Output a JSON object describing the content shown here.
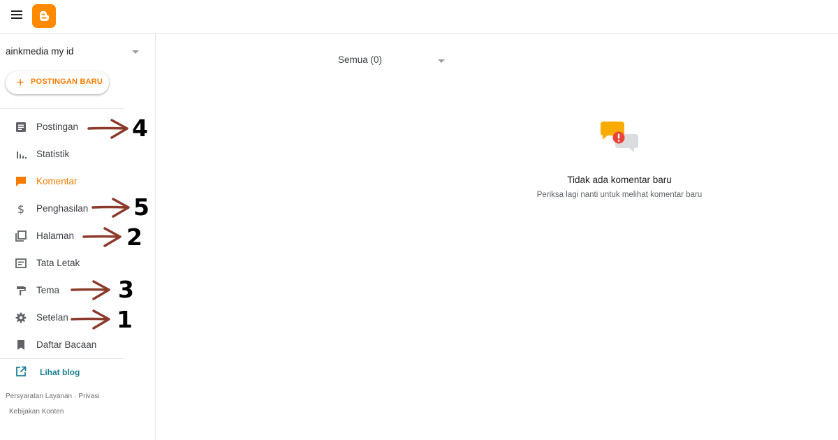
{
  "header": {
    "menu_icon": "hamburger-icon",
    "logo_icon": "blogger-logo-icon",
    "brand_color": "#ff8a00"
  },
  "sidebar": {
    "blog_name": "ainkmedia my id",
    "new_post_label": "POSTINGAN BARU",
    "accent_color": "#f57c00",
    "items": [
      {
        "label": "Postingan",
        "icon": "posts-icon"
      },
      {
        "label": "Statistik",
        "icon": "stats-icon"
      },
      {
        "label": "Komentar",
        "icon": "comment-icon",
        "active": true
      },
      {
        "label": "Penghasilan",
        "icon": "dollar-icon"
      },
      {
        "label": "Halaman",
        "icon": "pages-icon"
      },
      {
        "label": "Tata Letak",
        "icon": "layout-icon"
      },
      {
        "label": "Tema",
        "icon": "paint-roller-icon"
      },
      {
        "label": "Setelan",
        "icon": "gear-icon"
      },
      {
        "label": "Daftar Bacaan",
        "icon": "bookmark-icon"
      }
    ],
    "view_blog_label": "Lihat blog",
    "footer": {
      "terms": "Persyaratan Layanan",
      "privacy": "Privasi",
      "content_policy": "Kebijakan Konten"
    }
  },
  "annotations": [
    {
      "number": "4",
      "target": "Postingan"
    },
    {
      "number": "5",
      "target": "Penghasilan"
    },
    {
      "number": "2",
      "target": "Halaman"
    },
    {
      "number": "3",
      "target": "Tema"
    },
    {
      "number": "1",
      "target": "Setelan"
    }
  ],
  "main": {
    "filter_label": "Semua (0)",
    "empty_title": "Tidak ada komentar baru",
    "empty_subtitle": "Periksa lagi nanti untuk melihat komentar baru"
  }
}
